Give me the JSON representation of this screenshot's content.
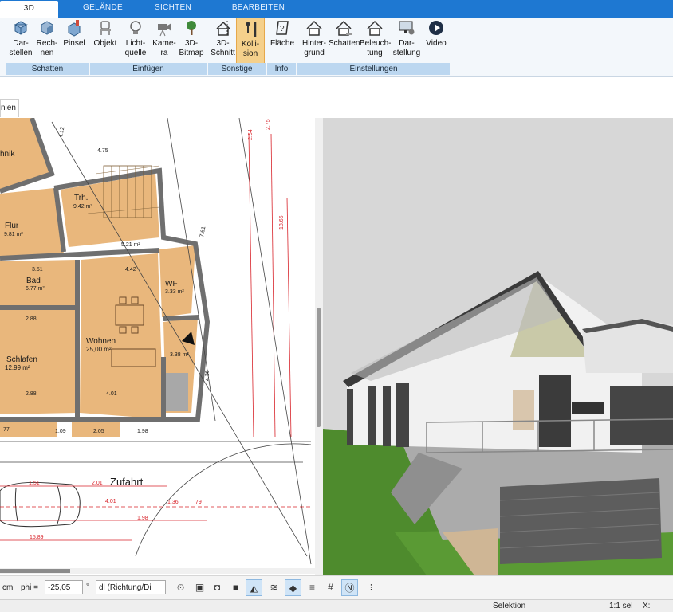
{
  "tabs": [
    {
      "label": "3D",
      "active": true
    },
    {
      "label": "GELÄNDE"
    },
    {
      "label": "SICHTEN"
    },
    {
      "label": "BEARBEITEN"
    }
  ],
  "ribbon": {
    "buttons": {
      "darstellen": "Dar-\nstellen",
      "rechnen": "Rech-\nnen",
      "pinsel": "Pinsel",
      "objekt": "Objekt",
      "lichtquelle": "Licht-\nquelle",
      "kamera": "Kame-\nra",
      "bitmap3d": "3D-\nBitmap",
      "schnitt3d": "3D-\nSchnitt",
      "kollision": "Kolli-\nsion",
      "flaeche": "Fläche",
      "hintergrund": "Hinter-\ngrund",
      "schatten": "Schatten",
      "beleuchtung": "Beleuch-\ntung",
      "darstellung": "Dar-\nstellung",
      "video": "Video"
    },
    "groups": {
      "schatten": "Schatten",
      "einfuegen": "Einfügen",
      "sonstige": "Sonstige",
      "info": "Info",
      "einstellungen": "Einstellungen"
    }
  },
  "doc_tab": "nien",
  "plan": {
    "rooms": {
      "technik": "hnik",
      "trh": "Trh.",
      "trh_area": "9.42 m²",
      "flur": "Flur",
      "flur_area": "9.81 m²",
      "bad": "Bad",
      "bad_area": "6.77 m²",
      "wf": "WF",
      "wf_area": "3.33 m²",
      "wohnen": "Wohnen",
      "wohnen_area": "25,00 m²",
      "schlafen": "Schlafen",
      "schlafen_area": "12.99 m²",
      "room5": "5.21 m²",
      "room_small": "3.38 m²",
      "zufahrt": "Zufahrt"
    },
    "dims": {
      "d475": "4.75",
      "d412": "4.12",
      "d351": "3.51",
      "d442": "4.42",
      "d288a": "2.88",
      "d288b": "2.88",
      "d401": "4.01",
      "d109": "1.09",
      "d198": "1.98",
      "d205": "2.05",
      "d77": "77",
      "d151": "1.51",
      "d201": "2.01",
      "d401b": "4.01",
      "d136": "1.36",
      "d79": "79",
      "d1589": "15.89",
      "d198b": "1.98",
      "d436": "4.36",
      "d761": "7.61",
      "d1866": "18.66",
      "d264": "2.64",
      "d275": "2.75"
    }
  },
  "bottom": {
    "unit": "cm",
    "phi_label": "phi =",
    "phi_value": "-25,05",
    "degree": "°",
    "dl_value": "dl (Richtung/Di"
  },
  "status": {
    "mode": "Selektion",
    "scale": "1:1 sel",
    "x_label": "X:"
  },
  "colors": {
    "tabbar": "#1e78d2",
    "ribbon_group": "#bcd7f0",
    "selected_button": "#f5d08b",
    "floor_wood": "#e9b77c",
    "wall": "#6f6f6f",
    "dimension_red": "#d8232a"
  }
}
